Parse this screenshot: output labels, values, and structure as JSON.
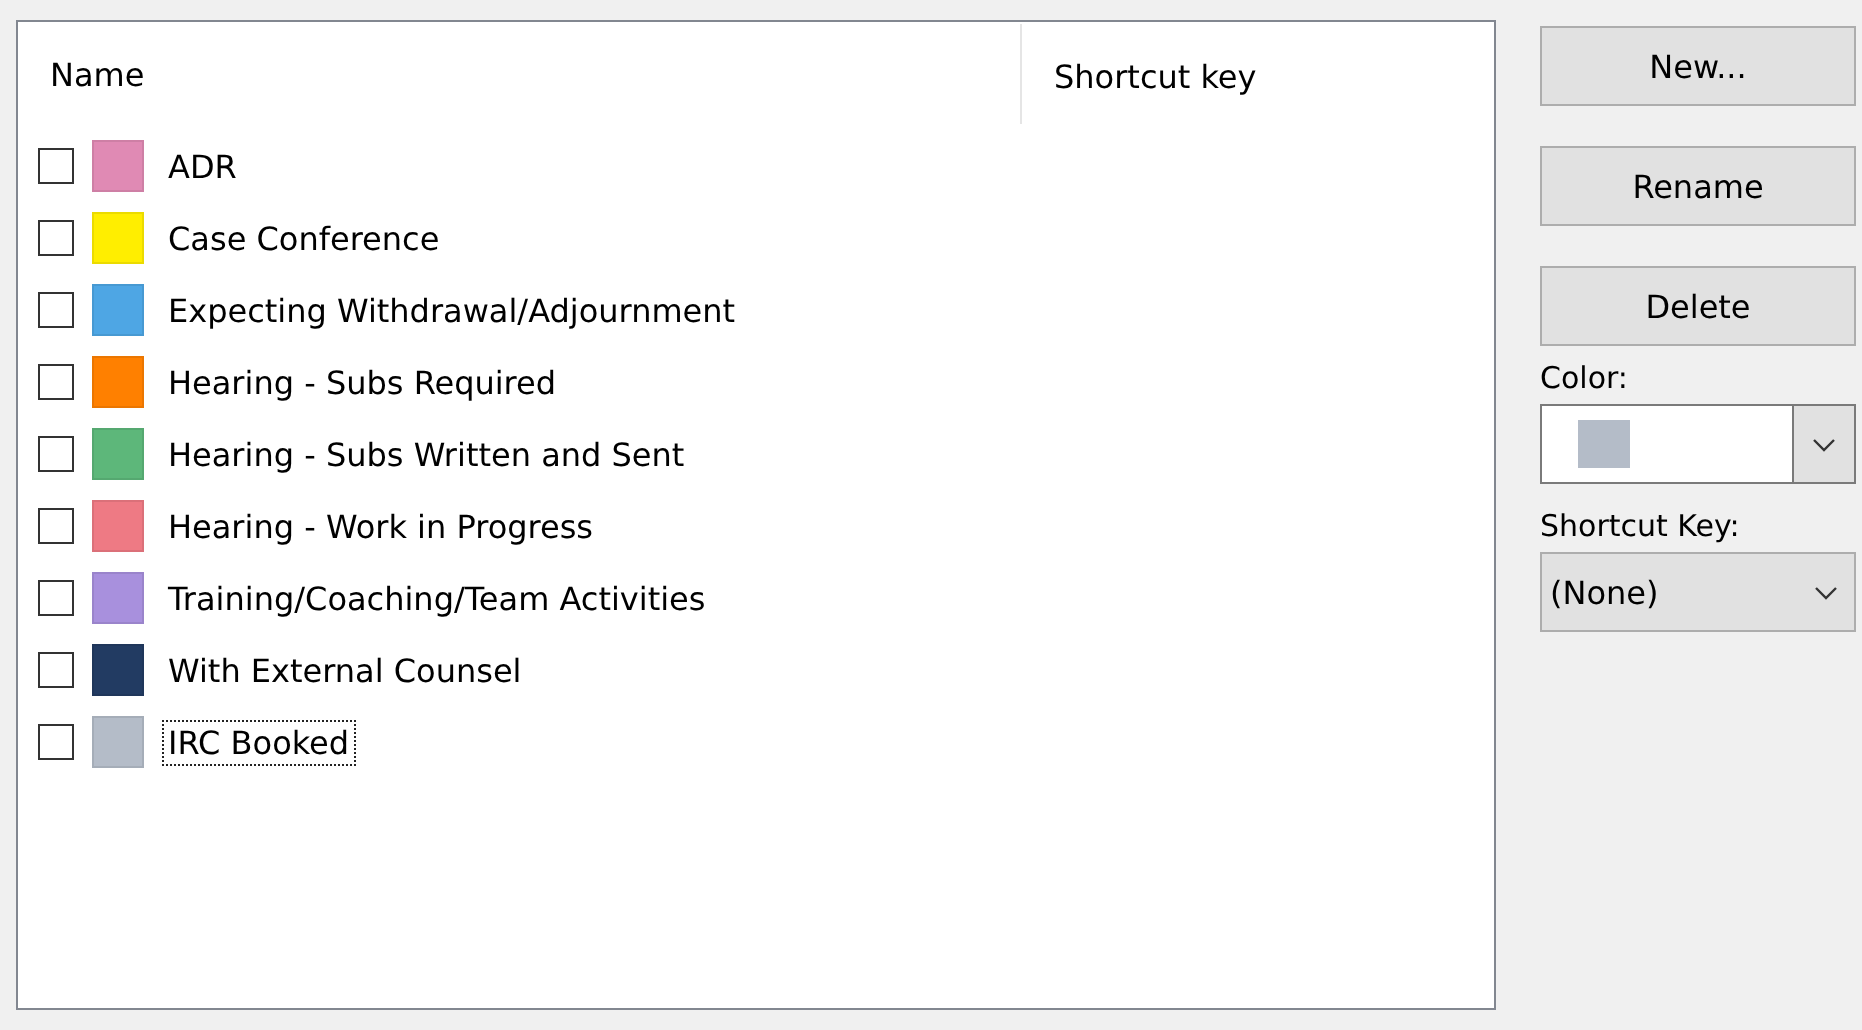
{
  "list": {
    "columns": [
      "Name",
      "Shortcut key"
    ],
    "items": [
      {
        "name": "ADR",
        "color": "#e08ab4",
        "checked": false,
        "focused": false
      },
      {
        "name": "Case Conference",
        "color": "#ffee00",
        "checked": false,
        "focused": false
      },
      {
        "name": "Expecting Withdrawal/Adjournment",
        "color": "#4ea6e4",
        "checked": false,
        "focused": false
      },
      {
        "name": "Hearing - Subs Required",
        "color": "#ff8000",
        "checked": false,
        "focused": false
      },
      {
        "name": "Hearing - Subs Written and Sent",
        "color": "#5db77a",
        "checked": false,
        "focused": false
      },
      {
        "name": "Hearing - Work in Progress",
        "color": "#ee7a84",
        "checked": false,
        "focused": false
      },
      {
        "name": "Training/Coaching/Team Activities",
        "color": "#a890dd",
        "checked": false,
        "focused": false
      },
      {
        "name": "With External Counsel",
        "color": "#223b62",
        "checked": false,
        "focused": false
      },
      {
        "name": "IRC Booked",
        "color": "#b4bcc8",
        "checked": false,
        "focused": true
      }
    ]
  },
  "buttons": [
    "New...",
    "Rename",
    "Delete"
  ],
  "color_picker": {
    "label": "Color:",
    "color": "#b4bcc8"
  },
  "shortcut": {
    "label": "Shortcut Key:",
    "value": "(None)"
  }
}
